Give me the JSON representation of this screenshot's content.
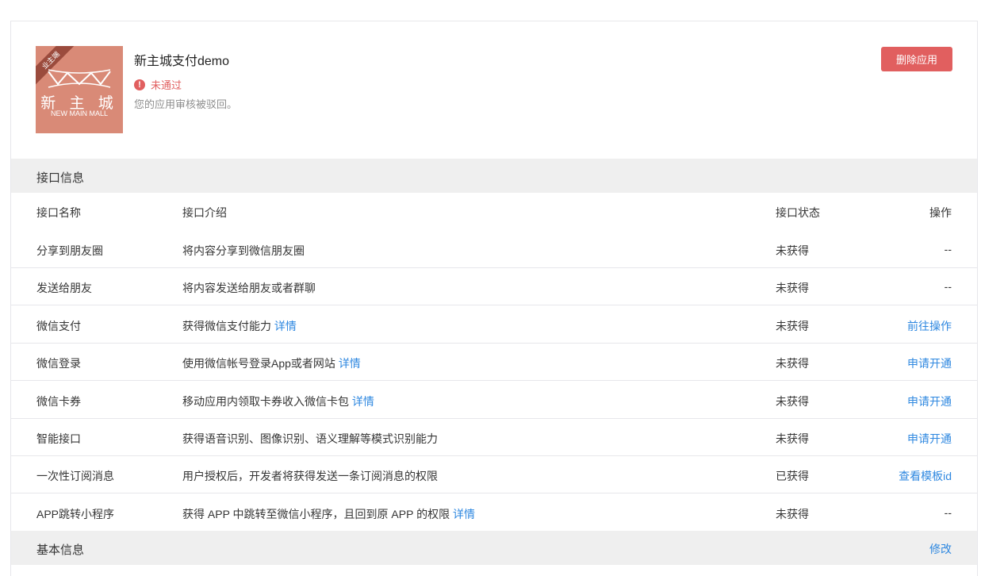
{
  "app": {
    "name": "新主城支付demo",
    "status": "未通过",
    "status_desc": "您的应用审核被驳回。",
    "delete_label": "删除应用",
    "logo": {
      "ribbon": "业主端",
      "cn": "新 主 城",
      "en": "NEW MAIN MALL"
    },
    "colors": {
      "danger": "#e15f5f",
      "link": "#2f88e0",
      "logo_bg": "#d98a77"
    }
  },
  "api_section": {
    "title": "接口信息",
    "headers": {
      "name": "接口名称",
      "desc": "接口介绍",
      "status": "接口状态",
      "op": "操作"
    },
    "rows": [
      {
        "name": "分享到朋友圈",
        "desc": "将内容分享到微信朋友圈",
        "detail": "",
        "status": "未获得",
        "op": "--"
      },
      {
        "name": "发送给朋友",
        "desc": "将内容发送给朋友或者群聊",
        "detail": "",
        "status": "未获得",
        "op": "--"
      },
      {
        "name": "微信支付",
        "desc": "获得微信支付能力",
        "detail": "详情",
        "status": "未获得",
        "op": "前往操作"
      },
      {
        "name": "微信登录",
        "desc": "使用微信帐号登录App或者网站",
        "detail": "详情",
        "status": "未获得",
        "op": "申请开通"
      },
      {
        "name": "微信卡券",
        "desc": "移动应用内领取卡券收入微信卡包",
        "detail": "详情",
        "status": "未获得",
        "op": "申请开通"
      },
      {
        "name": "智能接口",
        "desc": "获得语音识别、图像识别、语义理解等模式识别能力",
        "detail": "",
        "status": "未获得",
        "op": "申请开通"
      },
      {
        "name": "一次性订阅消息",
        "desc": "用户授权后，开发者将获得发送一条订阅消息的权限",
        "detail": "",
        "status": "已获得",
        "op": "查看模板id"
      },
      {
        "name": "APP跳转小程序",
        "desc": "获得 APP 中跳转至微信小程序，且回到原 APP 的权限",
        "detail": "详情",
        "status": "未获得",
        "op": "--"
      }
    ]
  },
  "basic_section": {
    "title": "基本信息",
    "edit_label": "修改"
  }
}
